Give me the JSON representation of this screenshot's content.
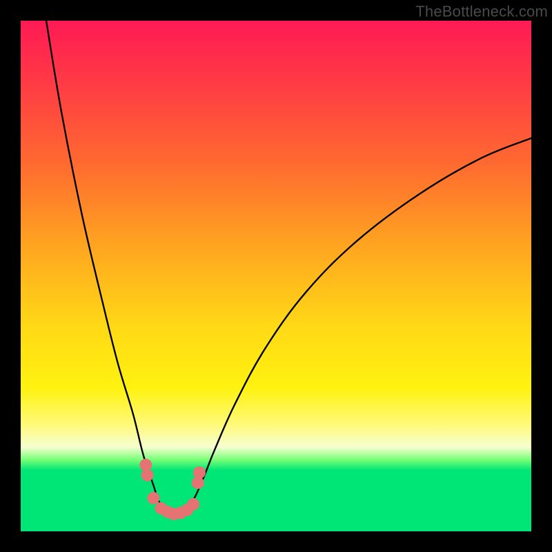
{
  "watermark": "TheBottleneck.com",
  "colors": {
    "gradient_top": "#ff1a55",
    "gradient_mid": "#fff210",
    "gradient_bottom": "#00e676",
    "curve": "#000000",
    "marker": "#e67373",
    "frame": "#000000"
  },
  "chart_data": {
    "type": "line",
    "title": "",
    "xlabel": "",
    "ylabel": "",
    "xlim": [
      0,
      100
    ],
    "ylim": [
      0,
      100
    ],
    "note": "No axis labels or tick marks visible; x and y normalized 0–100. Two black curves descend into a shallow basin near x≈30. Salmon dots mark the basin rim. The background is a vertical red→yellow→green gradient.",
    "series": [
      {
        "name": "left-curve",
        "x": [
          5,
          8,
          12,
          16,
          19,
          22,
          24,
          26,
          27,
          28.5,
          30
        ],
        "y": [
          100,
          82,
          62,
          45,
          33,
          23,
          15,
          9,
          6,
          4,
          3
        ]
      },
      {
        "name": "right-curve",
        "x": [
          30,
          32,
          34,
          36,
          38,
          42,
          48,
          56,
          66,
          78,
          90,
          100
        ],
        "y": [
          3,
          4,
          6.5,
          11,
          16,
          25,
          36,
          47,
          57,
          66,
          73,
          77
        ]
      }
    ],
    "markers": [
      {
        "x": 24.5,
        "y": 13
      },
      {
        "x": 24.8,
        "y": 11
      },
      {
        "x": 26.0,
        "y": 6.5
      },
      {
        "x": 27.5,
        "y": 4.5
      },
      {
        "x": 28.8,
        "y": 3.8
      },
      {
        "x": 30.0,
        "y": 3.4
      },
      {
        "x": 31.3,
        "y": 3.6
      },
      {
        "x": 32.6,
        "y": 4.2
      },
      {
        "x": 33.8,
        "y": 5.3
      },
      {
        "x": 34.7,
        "y": 9.5
      },
      {
        "x": 35.0,
        "y": 11.5
      }
    ]
  }
}
